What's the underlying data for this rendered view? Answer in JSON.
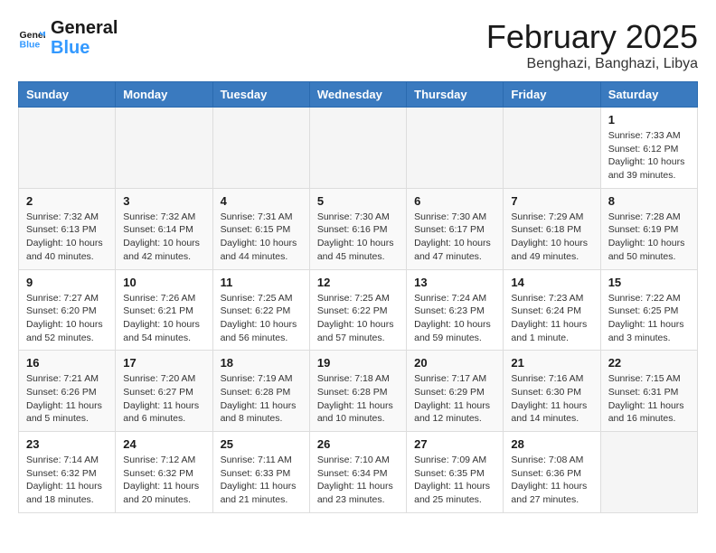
{
  "logo": {
    "text_general": "General",
    "text_blue": "Blue"
  },
  "title": "February 2025",
  "location": "Benghazi, Banghazi, Libya",
  "days_of_week": [
    "Sunday",
    "Monday",
    "Tuesday",
    "Wednesday",
    "Thursday",
    "Friday",
    "Saturday"
  ],
  "weeks": [
    [
      {
        "day": "",
        "info": ""
      },
      {
        "day": "",
        "info": ""
      },
      {
        "day": "",
        "info": ""
      },
      {
        "day": "",
        "info": ""
      },
      {
        "day": "",
        "info": ""
      },
      {
        "day": "",
        "info": ""
      },
      {
        "day": "1",
        "info": "Sunrise: 7:33 AM\nSunset: 6:12 PM\nDaylight: 10 hours\nand 39 minutes."
      }
    ],
    [
      {
        "day": "2",
        "info": "Sunrise: 7:32 AM\nSunset: 6:13 PM\nDaylight: 10 hours\nand 40 minutes."
      },
      {
        "day": "3",
        "info": "Sunrise: 7:32 AM\nSunset: 6:14 PM\nDaylight: 10 hours\nand 42 minutes."
      },
      {
        "day": "4",
        "info": "Sunrise: 7:31 AM\nSunset: 6:15 PM\nDaylight: 10 hours\nand 44 minutes."
      },
      {
        "day": "5",
        "info": "Sunrise: 7:30 AM\nSunset: 6:16 PM\nDaylight: 10 hours\nand 45 minutes."
      },
      {
        "day": "6",
        "info": "Sunrise: 7:30 AM\nSunset: 6:17 PM\nDaylight: 10 hours\nand 47 minutes."
      },
      {
        "day": "7",
        "info": "Sunrise: 7:29 AM\nSunset: 6:18 PM\nDaylight: 10 hours\nand 49 minutes."
      },
      {
        "day": "8",
        "info": "Sunrise: 7:28 AM\nSunset: 6:19 PM\nDaylight: 10 hours\nand 50 minutes."
      }
    ],
    [
      {
        "day": "9",
        "info": "Sunrise: 7:27 AM\nSunset: 6:20 PM\nDaylight: 10 hours\nand 52 minutes."
      },
      {
        "day": "10",
        "info": "Sunrise: 7:26 AM\nSunset: 6:21 PM\nDaylight: 10 hours\nand 54 minutes."
      },
      {
        "day": "11",
        "info": "Sunrise: 7:25 AM\nSunset: 6:22 PM\nDaylight: 10 hours\nand 56 minutes."
      },
      {
        "day": "12",
        "info": "Sunrise: 7:25 AM\nSunset: 6:22 PM\nDaylight: 10 hours\nand 57 minutes."
      },
      {
        "day": "13",
        "info": "Sunrise: 7:24 AM\nSunset: 6:23 PM\nDaylight: 10 hours\nand 59 minutes."
      },
      {
        "day": "14",
        "info": "Sunrise: 7:23 AM\nSunset: 6:24 PM\nDaylight: 11 hours\nand 1 minute."
      },
      {
        "day": "15",
        "info": "Sunrise: 7:22 AM\nSunset: 6:25 PM\nDaylight: 11 hours\nand 3 minutes."
      }
    ],
    [
      {
        "day": "16",
        "info": "Sunrise: 7:21 AM\nSunset: 6:26 PM\nDaylight: 11 hours\nand 5 minutes."
      },
      {
        "day": "17",
        "info": "Sunrise: 7:20 AM\nSunset: 6:27 PM\nDaylight: 11 hours\nand 6 minutes."
      },
      {
        "day": "18",
        "info": "Sunrise: 7:19 AM\nSunset: 6:28 PM\nDaylight: 11 hours\nand 8 minutes."
      },
      {
        "day": "19",
        "info": "Sunrise: 7:18 AM\nSunset: 6:28 PM\nDaylight: 11 hours\nand 10 minutes."
      },
      {
        "day": "20",
        "info": "Sunrise: 7:17 AM\nSunset: 6:29 PM\nDaylight: 11 hours\nand 12 minutes."
      },
      {
        "day": "21",
        "info": "Sunrise: 7:16 AM\nSunset: 6:30 PM\nDaylight: 11 hours\nand 14 minutes."
      },
      {
        "day": "22",
        "info": "Sunrise: 7:15 AM\nSunset: 6:31 PM\nDaylight: 11 hours\nand 16 minutes."
      }
    ],
    [
      {
        "day": "23",
        "info": "Sunrise: 7:14 AM\nSunset: 6:32 PM\nDaylight: 11 hours\nand 18 minutes."
      },
      {
        "day": "24",
        "info": "Sunrise: 7:12 AM\nSunset: 6:32 PM\nDaylight: 11 hours\nand 20 minutes."
      },
      {
        "day": "25",
        "info": "Sunrise: 7:11 AM\nSunset: 6:33 PM\nDaylight: 11 hours\nand 21 minutes."
      },
      {
        "day": "26",
        "info": "Sunrise: 7:10 AM\nSunset: 6:34 PM\nDaylight: 11 hours\nand 23 minutes."
      },
      {
        "day": "27",
        "info": "Sunrise: 7:09 AM\nSunset: 6:35 PM\nDaylight: 11 hours\nand 25 minutes."
      },
      {
        "day": "28",
        "info": "Sunrise: 7:08 AM\nSunset: 6:36 PM\nDaylight: 11 hours\nand 27 minutes."
      },
      {
        "day": "",
        "info": ""
      }
    ]
  ]
}
